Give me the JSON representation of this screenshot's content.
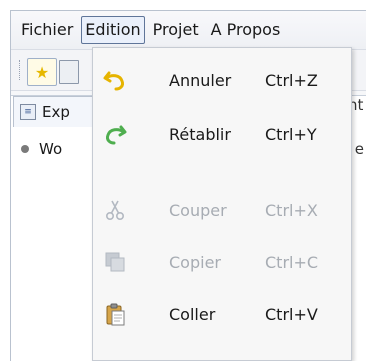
{
  "menubar": {
    "items": [
      {
        "label": "Fichier",
        "active": false
      },
      {
        "label": "Edition",
        "active": true
      },
      {
        "label": "Projet",
        "active": false
      },
      {
        "label": "A Propos",
        "active": false
      }
    ]
  },
  "panel": {
    "tab_label": "Exp",
    "right_stub_top": "nt",
    "tree_item_label": "Wo",
    "right_stub_row": "e"
  },
  "dropdown": {
    "items": [
      {
        "label": "Annuler",
        "shortcut": "Ctrl+Z",
        "icon": "undo-icon",
        "enabled": true
      },
      {
        "label": "Rétablir",
        "shortcut": "Ctrl+Y",
        "icon": "redo-icon",
        "enabled": true
      },
      {
        "label": "Couper",
        "shortcut": "Ctrl+X",
        "icon": "scissors-icon",
        "enabled": false
      },
      {
        "label": "Copier",
        "shortcut": "Ctrl+C",
        "icon": "copy-icon",
        "enabled": false
      },
      {
        "label": "Coller",
        "shortcut": "Ctrl+V",
        "icon": "paste-icon",
        "enabled": true
      }
    ]
  },
  "colors": {
    "active_menu_border": "#5f7599",
    "disabled_text": "#a7acb3"
  }
}
